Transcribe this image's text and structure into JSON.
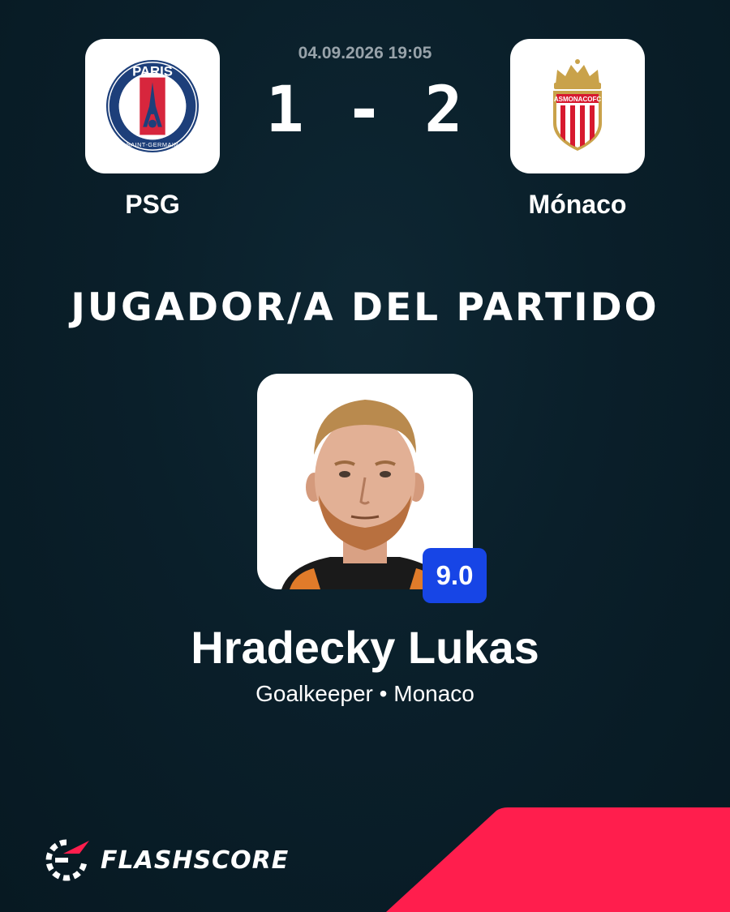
{
  "match": {
    "datetime": "04.09.2026 19:05",
    "score": "1 - 2",
    "home": {
      "name": "PSG",
      "crest_text": "PARIS",
      "crest_subtext": "SAINT-GERMAIN"
    },
    "away": {
      "name": "Mónaco",
      "crest_text": "ASMONACOFC"
    }
  },
  "award": {
    "title": "JUGADOR/A DEL PARTIDO"
  },
  "player": {
    "name": "Hradecky Lukas",
    "meta": "Goalkeeper • Monaco",
    "rating": "9.0"
  },
  "brand": {
    "name": "FLASHSCORE"
  },
  "colors": {
    "background": "#0a1f2a",
    "accent_red": "#ff1e4d",
    "rating_blue": "#1745e6",
    "psg_navy": "#1d3f7a",
    "psg_red": "#d7263d",
    "monaco_red": "#d7192f",
    "monaco_gold": "#c9a24a"
  }
}
